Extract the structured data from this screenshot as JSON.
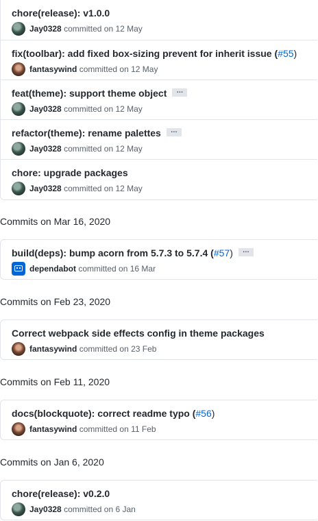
{
  "group0": {
    "commits": [
      {
        "message": "chore(release): v1.0.0",
        "author": "Jay0328",
        "action": "committed",
        "date": "on 12 May",
        "avatar": "jay0328-avatar"
      },
      {
        "message": "fix(toolbar): add fixed box-sizing prevent for inherit issue (",
        "link": "#55",
        "message_end": ")",
        "author": "fantasywind",
        "action": "committed",
        "date": "on 12 May",
        "avatar": "fantasywind-avatar"
      },
      {
        "message": "feat(theme): support theme object",
        "ellipsis": "…",
        "author": "Jay0328",
        "action": "committed",
        "date": "on 12 May",
        "avatar": "jay0328-avatar"
      },
      {
        "message": "refactor(theme): rename palettes",
        "ellipsis": "…",
        "author": "Jay0328",
        "action": "committed",
        "date": "on 12 May",
        "avatar": "jay0328-avatar"
      },
      {
        "message": "chore: upgrade packages",
        "author": "Jay0328",
        "action": "committed",
        "date": "on 12 May",
        "avatar": "jay0328-avatar"
      }
    ]
  },
  "group1": {
    "header": "Commits on Mar 16, 2020",
    "commits": [
      {
        "message": "build(deps): bump acorn from 5.7.3 to 5.7.4 (",
        "link": "#57",
        "message_end": ")",
        "ellipsis": "…",
        "author": "dependabot",
        "action": "committed",
        "date": "on 16 Mar",
        "avatar": "dependabot-avatar"
      }
    ]
  },
  "group2": {
    "header": "Commits on Feb 23, 2020",
    "commits": [
      {
        "message": "Correct webpack side effects config in theme packages",
        "author": "fantasywind",
        "action": "committed",
        "date": "on 23 Feb",
        "avatar": "fantasywind-avatar"
      }
    ]
  },
  "group3": {
    "header": "Commits on Feb 11, 2020",
    "commits": [
      {
        "message": "docs(blockquote): correct readme typo (",
        "link": "#56",
        "message_end": ")",
        "author": "fantasywind",
        "action": "committed",
        "date": "on 11 Feb",
        "avatar": "fantasywind-avatar"
      }
    ]
  },
  "group4": {
    "header": "Commits on Jan 6, 2020",
    "commits": [
      {
        "message": "chore(release): v0.2.0",
        "author": "Jay0328",
        "action": "committed",
        "date": "on 6 Jan",
        "avatar": "jay0328-avatar"
      }
    ]
  },
  "colors": {
    "link": "#0366d6",
    "border": "#e1e4e8",
    "muted": "#586069",
    "text": "#24292e"
  }
}
